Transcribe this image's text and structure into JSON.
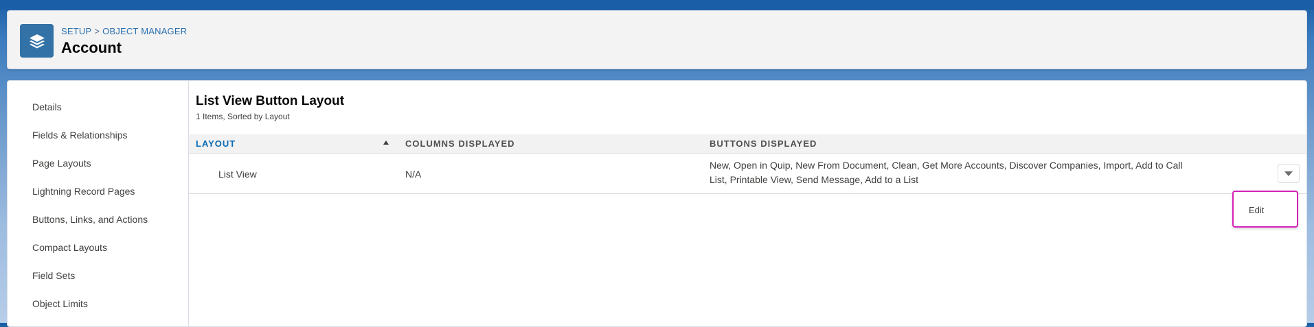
{
  "header": {
    "breadcrumb": [
      "SETUP",
      "OBJECT MANAGER"
    ],
    "breadcrumb_separator": ">",
    "title": "Account",
    "icon": "layers-icon"
  },
  "sidebar": {
    "items": [
      {
        "label": "Details"
      },
      {
        "label": "Fields & Relationships"
      },
      {
        "label": "Page Layouts"
      },
      {
        "label": "Lightning Record Pages"
      },
      {
        "label": "Buttons, Links, and Actions"
      },
      {
        "label": "Compact Layouts"
      },
      {
        "label": "Field Sets"
      },
      {
        "label": "Object Limits"
      }
    ]
  },
  "list": {
    "title": "List View Button Layout",
    "subtitle": "1 Items, Sorted by Layout",
    "columns": [
      "LAYOUT",
      "COLUMNS DISPLAYED",
      "BUTTONS DISPLAYED"
    ],
    "sorted_column": "LAYOUT",
    "rows": [
      {
        "layout": "List View",
        "columns_displayed": "N/A",
        "buttons_displayed_line1": "New, Open in Quip, New From Document, Clean, Get More Accounts, Discover Companies, Import, Add to Call",
        "buttons_displayed_line2": "List, Printable View, Send Message, Add to a List"
      }
    ]
  },
  "row_menu": {
    "items": [
      {
        "label": "Edit"
      }
    ]
  },
  "colors": {
    "accent": "#0a6ab4",
    "icon_bg": "#3372a6",
    "highlight_border": "#d322b8"
  }
}
